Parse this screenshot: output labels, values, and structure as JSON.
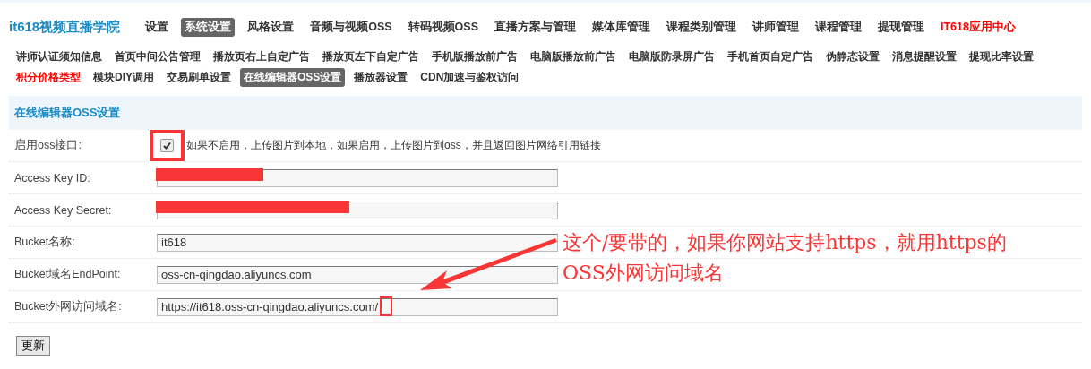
{
  "brand": "it618视频直播学院",
  "main_nav": [
    {
      "label": "设置",
      "selected": false,
      "kind": "normal"
    },
    {
      "label": "系统设置",
      "selected": true,
      "kind": "normal"
    },
    {
      "label": "风格设置",
      "selected": false,
      "kind": "normal"
    },
    {
      "label": "音频与视频OSS",
      "selected": false,
      "kind": "normal"
    },
    {
      "label": "转码视频OSS",
      "selected": false,
      "kind": "normal"
    },
    {
      "label": "直播方案与管理",
      "selected": false,
      "kind": "normal"
    },
    {
      "label": "媒体库管理",
      "selected": false,
      "kind": "normal"
    },
    {
      "label": "课程类别管理",
      "selected": false,
      "kind": "normal"
    },
    {
      "label": "讲师管理",
      "selected": false,
      "kind": "normal"
    },
    {
      "label": "课程管理",
      "selected": false,
      "kind": "normal"
    },
    {
      "label": "提现管理",
      "selected": false,
      "kind": "normal"
    },
    {
      "label": "IT618应用中心",
      "selected": false,
      "kind": "promo"
    }
  ],
  "sub_nav": [
    {
      "label": "讲师认证须知信息",
      "selected": false,
      "kind": "normal"
    },
    {
      "label": "首页中间公告管理",
      "selected": false,
      "kind": "normal"
    },
    {
      "label": "播放页右上自定广告",
      "selected": false,
      "kind": "normal"
    },
    {
      "label": "播放页左下自定广告",
      "selected": false,
      "kind": "normal"
    },
    {
      "label": "手机版播放前广告",
      "selected": false,
      "kind": "normal"
    },
    {
      "label": "电脑版播放前广告",
      "selected": false,
      "kind": "normal"
    },
    {
      "label": "电脑版防录屏广告",
      "selected": false,
      "kind": "normal"
    },
    {
      "label": "手机首页自定广告",
      "selected": false,
      "kind": "normal"
    },
    {
      "label": "伪静态设置",
      "selected": false,
      "kind": "normal"
    },
    {
      "label": "消息提醒设置",
      "selected": false,
      "kind": "normal"
    },
    {
      "label": "提现比率设置",
      "selected": false,
      "kind": "normal"
    },
    {
      "label": "积分价格类型",
      "selected": false,
      "kind": "promo"
    },
    {
      "label": "模块DIY调用",
      "selected": false,
      "kind": "normal"
    },
    {
      "label": "交易刷单设置",
      "selected": false,
      "kind": "normal"
    },
    {
      "label": "在线编辑器OSS设置",
      "selected": true,
      "kind": "normal"
    },
    {
      "label": "播放器设置",
      "selected": false,
      "kind": "normal"
    },
    {
      "label": "CDN加速与鉴权访问",
      "selected": false,
      "kind": "normal"
    }
  ],
  "panel": {
    "title": "在线编辑器OSS设置",
    "rows": [
      {
        "kind": "checkbox",
        "label": "启用oss接口:",
        "checked": true,
        "hint": "如果不启用，上传图片到本地，如果启用，上传图片到oss，并且返回图片网络引用链接"
      },
      {
        "kind": "redacted",
        "label": "Access Key ID:"
      },
      {
        "kind": "redacted",
        "label": "Access Key Secret:"
      },
      {
        "kind": "text",
        "label": "Bucket名称:",
        "value": "it618"
      },
      {
        "kind": "text",
        "label": "Bucket域名EndPoint:",
        "value": "oss-cn-qingdao.aliyuncs.com"
      },
      {
        "kind": "text",
        "label": "Bucket外网访问域名:",
        "value": "https://it618.oss-cn-qingdao.aliyuncs.com/",
        "highlight": true
      }
    ],
    "submit": "更新"
  },
  "annotation": "这个/要带的，如果你网站支持https，就用https的OSS外网访问域名"
}
